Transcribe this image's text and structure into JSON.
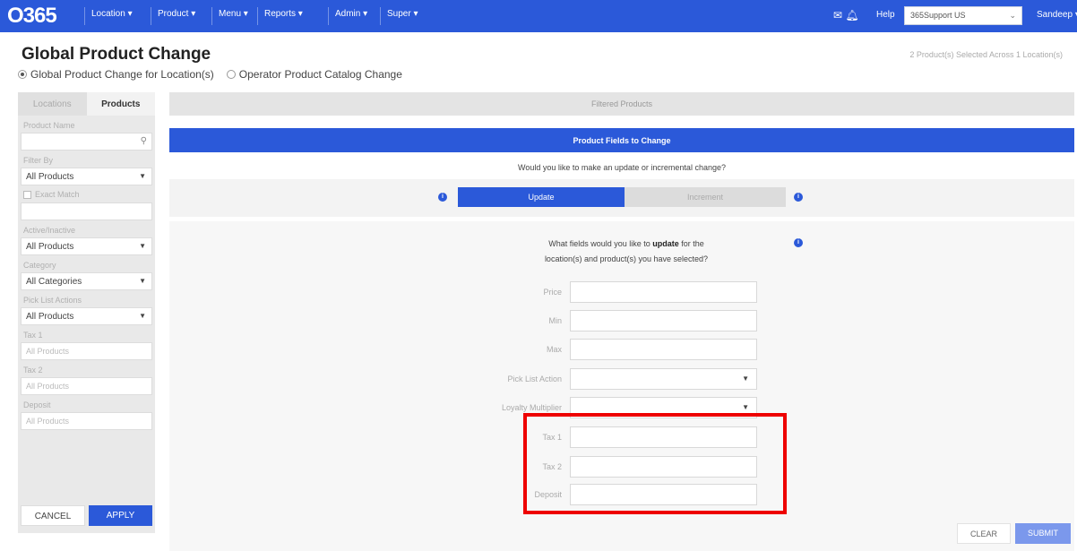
{
  "nav": {
    "logo": "O365",
    "items": [
      "Location ▾",
      "Product ▾",
      "Menu ▾",
      "Reports ▾",
      "Admin ▾",
      "Super ▾"
    ],
    "help": "Help",
    "account_select": "365Support US",
    "user": "Sandeep ▾"
  },
  "header": {
    "title": "Global Product Change",
    "right_text": "2 Product(s) Selected Across 1 Location(s)",
    "radio_global": "Global Product Change for Location(s)",
    "radio_operator": "Operator Product Catalog Change"
  },
  "sidebar": {
    "tab_locations": "Locations",
    "tab_products": "Products",
    "product_name_label": "Product Name",
    "filter_by_label": "Filter By",
    "filter_by_value": "All Products",
    "exact_match_label": "Exact Match",
    "active_label": "Active/Inactive",
    "active_value": "All Products",
    "category_label": "Category",
    "category_value": "All Categories",
    "picklist_label": "Pick List Actions",
    "picklist_value": "All Products",
    "tax1_label": "Tax 1",
    "tax1_placeholder": "All Products",
    "tax2_label": "Tax 2",
    "tax2_placeholder": "All Products",
    "deposit_label": "Deposit",
    "deposit_placeholder": "All Products",
    "cancel": "CANCEL",
    "apply": "APPLY"
  },
  "main": {
    "filtered_products": "Filtered Products",
    "fields_to_change": "Product Fields to Change",
    "update_question": "Would you like to make an update or incremental change?",
    "toggle_update": "Update",
    "toggle_increment": "Increment",
    "fields_question_pre": "What fields would you like to ",
    "fields_question_bold": "update",
    "fields_question_post": " for the",
    "fields_question_line2": "location(s) and product(s) you have selected?",
    "fields": [
      {
        "label": "Price"
      },
      {
        "label": "Min"
      },
      {
        "label": "Max"
      },
      {
        "label": "Pick List Action"
      },
      {
        "label": "Loyalty Multiplier"
      },
      {
        "label": "Tax 1"
      },
      {
        "label": "Tax 2"
      },
      {
        "label": "Deposit"
      }
    ],
    "clear": "CLEAR",
    "submit": "SUBMIT"
  },
  "colors": {
    "brand": "#2b59d9",
    "highlight": "#ee0000"
  },
  "icons": {
    "search": "search-icon",
    "info": "info-icon",
    "mail": "mail-icon",
    "bell": "bell-icon"
  }
}
